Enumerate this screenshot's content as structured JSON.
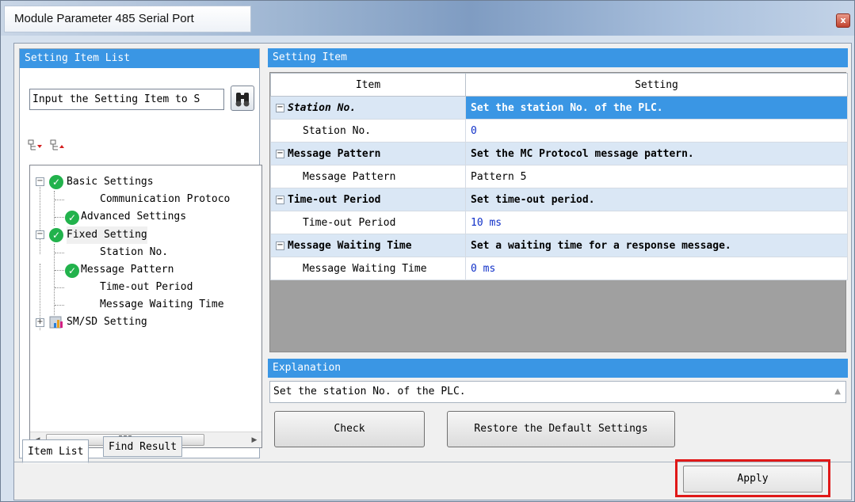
{
  "window": {
    "title": "Module Parameter 485 Serial Port",
    "close_glyph": "x"
  },
  "left_panel": {
    "header": "Setting Item List",
    "search": {
      "value": "Input the Setting Item to S",
      "icon": "binoculars-icon"
    },
    "toolbar_icons": [
      "expand-all-icon",
      "collapse-all-icon"
    ],
    "tree": [
      {
        "label": "Basic Settings",
        "expander": "−",
        "icon": "check-icon"
      },
      {
        "label": "Communication Protoco",
        "icon": "none"
      },
      {
        "label": "Advanced Settings",
        "icon": "check-icon"
      },
      {
        "label": "Fixed Setting",
        "expander": "−",
        "icon": "check-icon"
      },
      {
        "label": "Station No.",
        "icon": "none"
      },
      {
        "label": "Message Pattern",
        "icon": "check-icon"
      },
      {
        "label": "Time-out Period",
        "icon": "none"
      },
      {
        "label": "Message Waiting Time",
        "icon": "none"
      },
      {
        "label": "SM/SD Setting",
        "expander": "+",
        "icon": "chart-icon"
      }
    ],
    "scroll_thumb_grip": "III",
    "tabs": [
      "Item List",
      "Find Result"
    ]
  },
  "right_panel": {
    "header": "Setting Item",
    "columns": [
      "Item",
      "Setting"
    ],
    "rows": [
      {
        "kind": "group",
        "item": "Station No.",
        "setting": "Set the station No. of the PLC.",
        "selected": true
      },
      {
        "kind": "item",
        "item": "Station No.",
        "setting": "0"
      },
      {
        "kind": "group",
        "item": "Message Pattern",
        "setting": "Set the MC Protocol message pattern."
      },
      {
        "kind": "item",
        "item": "Message Pattern",
        "setting": "Pattern 5"
      },
      {
        "kind": "group",
        "item": "Time-out Period",
        "setting": "Set time-out period."
      },
      {
        "kind": "item",
        "item": "Time-out Period",
        "setting": "10 ms"
      },
      {
        "kind": "group",
        "item": "Message Waiting Time",
        "setting": "Set a waiting time for a response message."
      },
      {
        "kind": "item",
        "item": "Message Waiting Time",
        "setting": "0 ms"
      }
    ],
    "explanation_header": "Explanation",
    "explanation_text": "Set the station No. of the PLC.",
    "check_button": "Check",
    "restore_button": "Restore the Default Settings"
  },
  "footer": {
    "apply_button": "Apply",
    "highlight_color": "#e01818"
  },
  "colors": {
    "accent": "#3a96e4",
    "group_row": "#dae7f5",
    "value_text": "#1030c8",
    "check_green": "#22b24c"
  }
}
